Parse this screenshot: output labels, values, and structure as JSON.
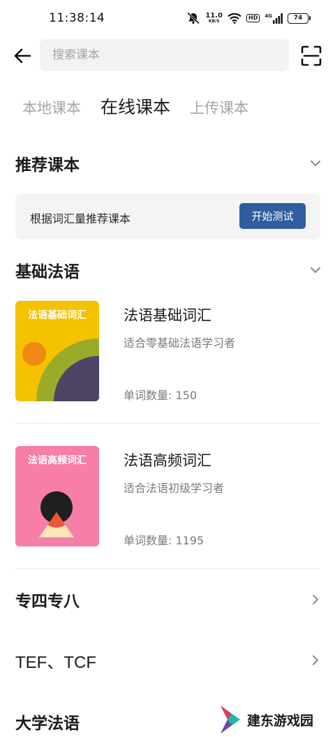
{
  "status_bar": {
    "time": "11:38:14",
    "net_speed": "11.0",
    "net_unit": "KB/S",
    "hd_label": "HD",
    "signal_label": "4G",
    "battery": "74"
  },
  "search": {
    "placeholder": "搜索课本"
  },
  "tabs": [
    {
      "label": "本地课本",
      "active": false
    },
    {
      "label": "在线课本",
      "active": true
    },
    {
      "label": "上传课本",
      "active": false
    }
  ],
  "recommend": {
    "section_title": "推荐课本",
    "card_text": "根据词汇量推荐课本",
    "button_label": "开始测试"
  },
  "basic_section": {
    "title": "基础法语",
    "books": [
      {
        "cover_title": "法语基础词汇",
        "title": "法语基础词汇",
        "description": "适合零基础法语学习者",
        "count": "单词数量: 150"
      },
      {
        "cover_title": "法语高频词汇",
        "title": "法语高频词汇",
        "description": "适合法语初级学习者",
        "count": "单词数量: 1195"
      }
    ]
  },
  "categories": [
    {
      "label": "专四专八"
    },
    {
      "label": "TEF、TCF"
    },
    {
      "label": "大学法语"
    }
  ],
  "watermark": {
    "text": "建东游戏园"
  },
  "colors": {
    "accent": "#2f5d9f",
    "cover1_bg": "#f5c200",
    "cover2_bg": "#f77ea6"
  }
}
